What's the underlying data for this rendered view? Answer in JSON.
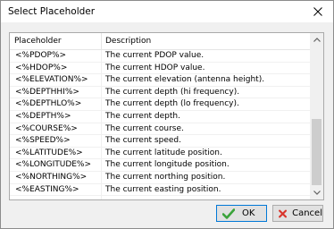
{
  "window": {
    "title": "Select Placeholder"
  },
  "columns": {
    "placeholder": "Placeholder",
    "description": "Description"
  },
  "rows": [
    {
      "placeholder": "<%PDOP%>",
      "description": "The current PDOP value."
    },
    {
      "placeholder": "<%HDOP%>",
      "description": "The current HDOP value."
    },
    {
      "placeholder": "<%ELEVATION%>",
      "description": "The current elevation (antenna height)."
    },
    {
      "placeholder": "<%DEPTHHI%>",
      "description": "The current depth (hi frequency)."
    },
    {
      "placeholder": "<%DEPTHLO%>",
      "description": "The current depth (lo frequency)."
    },
    {
      "placeholder": "<%DEPTH%>",
      "description": "The current depth."
    },
    {
      "placeholder": "<%COURSE%>",
      "description": "The current course."
    },
    {
      "placeholder": "<%SPEED%>",
      "description": "The current speed."
    },
    {
      "placeholder": "<%LATITUDE%>",
      "description": "The current latitude position."
    },
    {
      "placeholder": "<%LONGITUDE%>",
      "description": "The current longitude position."
    },
    {
      "placeholder": "<%NORTHING%>",
      "description": "The current northing position."
    },
    {
      "placeholder": "<%EASTING%>",
      "description": "The current easting position."
    }
  ],
  "buttons": {
    "ok": "OK",
    "cancel": "Cancel"
  },
  "icons": {
    "close": "close-icon",
    "ok": "checkmark-icon",
    "cancel": "cross-icon"
  },
  "colors": {
    "ok_check": "#3aa33a",
    "cancel_cross": "#d9342b",
    "focus_border": "#0078d7"
  }
}
